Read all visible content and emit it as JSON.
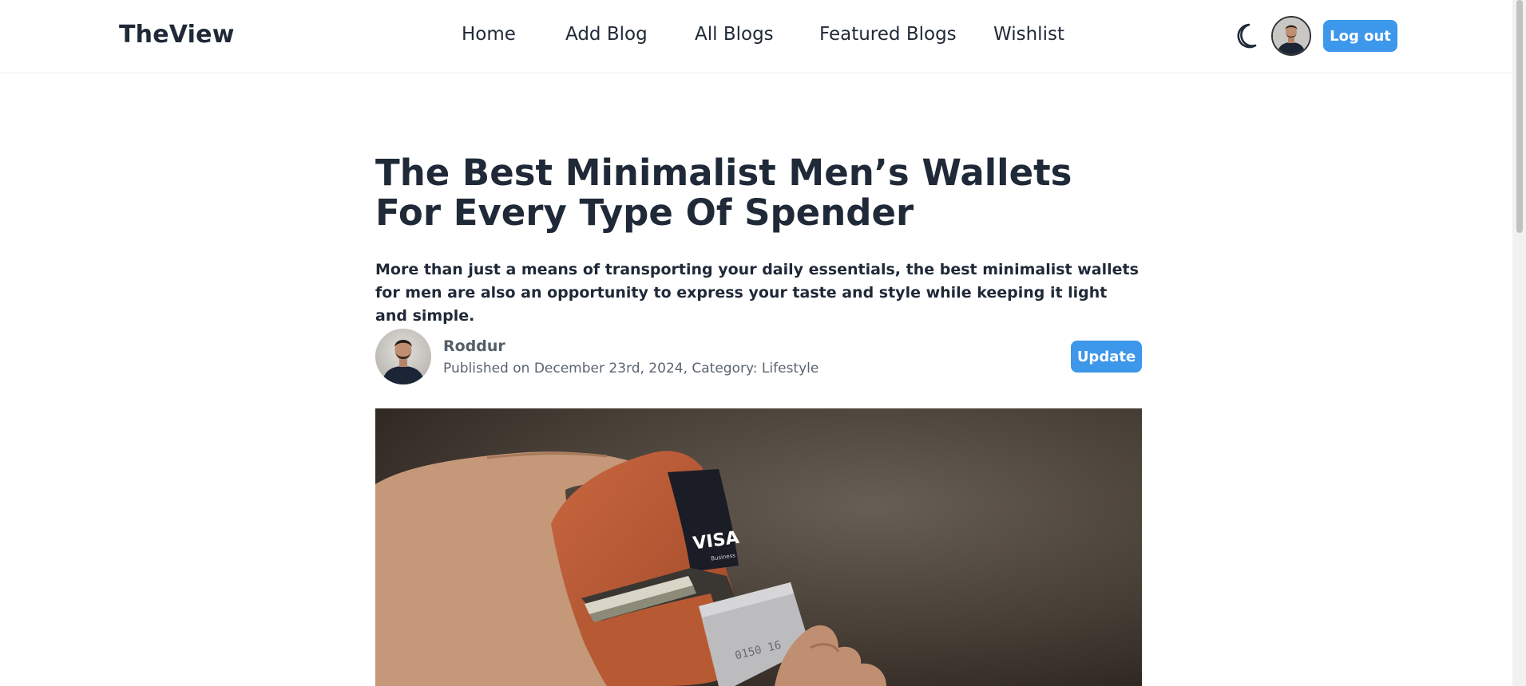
{
  "navbar": {
    "logo": "TheView",
    "links": [
      "Home",
      "Add Blog",
      "All Blogs",
      "Featured Blogs",
      "Wishlist"
    ],
    "logout_label": "Log out",
    "theme_icon": "moon-icon"
  },
  "post": {
    "title": "The Best Minimalist Men’s Wallets For Every Type Of Spender",
    "excerpt": "More than just a means of transporting your daily essentials, the best minimalist wallets for men are also an opportunity to express your taste and style while keeping it light and simple.",
    "author": "Roddur",
    "meta": "Published on December 23rd, 2024, Category: Lifestyle",
    "update_label": "Update",
    "card_text_1": "VISA",
    "card_text_2": "Business"
  },
  "colors": {
    "accent": "#3d97ea",
    "text": "#1f2937",
    "muted": "#5b6470"
  }
}
